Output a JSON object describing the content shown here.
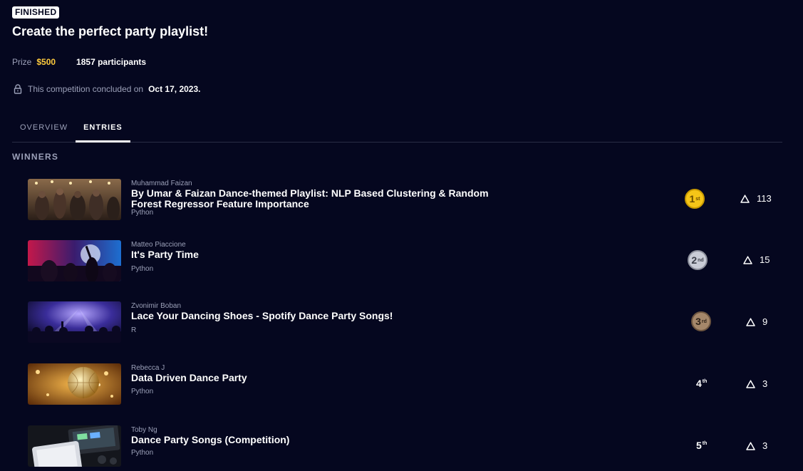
{
  "competition": {
    "status_badge": "FINISHED",
    "title": "Create the perfect party playlist!",
    "prize_label": "Prize",
    "prize_value": "$500",
    "participants": "1857 participants",
    "concluded_text": "This competition concluded on",
    "concluded_date": "Oct 17, 2023."
  },
  "tabs": [
    {
      "label": "OVERVIEW",
      "active": false
    },
    {
      "label": "ENTRIES",
      "active": true
    }
  ],
  "winners": {
    "section_title": "WINNERS",
    "entries": [
      {
        "author": "Muhammad Faizan",
        "title": "By Umar & Faizan Dance-themed Playlist: NLP Based Clustering & Random Forest Regressor Feature Importance",
        "language": "Python",
        "place": "1",
        "place_suffix": "st",
        "votes": "113",
        "thumb": "crowd-party"
      },
      {
        "author": "Matteo Piaccione",
        "title": "It's Party Time",
        "language": "Python",
        "place": "2",
        "place_suffix": "nd",
        "votes": "15",
        "thumb": "neon-party"
      },
      {
        "author": "Zvonimir Boban",
        "title": "Lace Your Dancing Shoes - Spotify Dance Party Songs!",
        "language": "R",
        "place": "3",
        "place_suffix": "rd",
        "votes": "9",
        "thumb": "concert-lights"
      },
      {
        "author": "Rebecca J",
        "title": "Data Driven Dance Party",
        "language": "Python",
        "place": "4",
        "place_suffix": "th",
        "votes": "3",
        "thumb": "disco-ball"
      },
      {
        "author": "Toby Ng",
        "title": "Dance Party Songs (Competition)",
        "language": "Python",
        "place": "5",
        "place_suffix": "th",
        "votes": "3",
        "thumb": "dj-controller"
      }
    ]
  },
  "colors": {
    "background": "#05071f",
    "prize": "#ffcb3d",
    "gold": "#f5c518",
    "silver": "#c9ccd6",
    "bronze": "#a5876a",
    "muted_text": "#9ba0b8"
  }
}
